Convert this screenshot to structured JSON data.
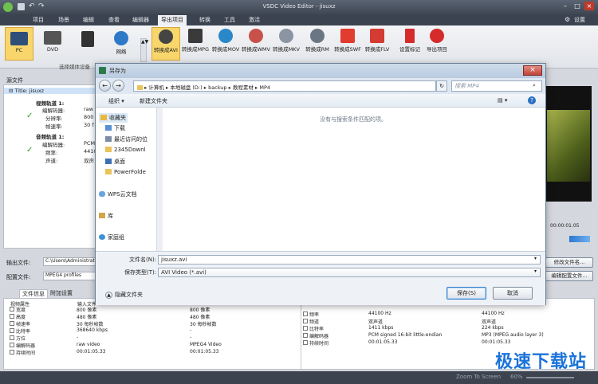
{
  "app": {
    "title": "VSDC Video Editor - jisuxz",
    "settings": "设置"
  },
  "menu": [
    "项目",
    "场景",
    "编辑",
    "查看",
    "编辑器",
    "导出项目",
    "转换",
    "工具",
    "激活"
  ],
  "ribbon": {
    "devices": [
      "PC",
      "DVD",
      "",
      "网络"
    ],
    "formats": [
      "转换成AVI",
      "转换成MPG",
      "转换成MOV",
      "转换成WMV",
      "转换成MKV",
      "转换成RM",
      "转换成SWF",
      "转换成FLV"
    ],
    "markers": [
      "设置标记",
      "导出项目"
    ],
    "group_label": "选择媒体设备"
  },
  "left_panel": {
    "source": "源文件",
    "title": "Title: jisuxz",
    "video_track": "视频轨道 1:",
    "video_props": [
      {
        "k": "编解码器:",
        "v": "raw"
      },
      {
        "k": "分辨率:",
        "v": "800"
      },
      {
        "k": "帧速率:",
        "v": "30 f"
      }
    ],
    "audio_track": "音频轨道 1:",
    "audio_props": [
      {
        "k": "编解码器:",
        "v": "PCM"
      },
      {
        "k": "频率:",
        "v": "4410"
      },
      {
        "k": "声道:",
        "v": "双声"
      }
    ],
    "output_label": "输出文件:",
    "output_value": "C:\\Users\\Administrator",
    "profile_label": "配置文件:",
    "profile_value": "MPEG4 profiles",
    "rename_btn": "修改文件名...",
    "edit_profile_btn": "编辑配置文件..."
  },
  "tabs": [
    "文件信息",
    "附加设置"
  ],
  "file_info": {
    "headers": [
      "视频属性",
      "输入文件"
    ],
    "video_rows": [
      {
        "k": "宽度",
        "in": "800 像素",
        "out": "800 像素"
      },
      {
        "k": "高度",
        "in": "480 像素",
        "out": "480 像素"
      },
      {
        "k": "帧速率",
        "in": "30 每秒帧数",
        "out": "30 每秒帧数"
      },
      {
        "k": "比特率",
        "in": "368640 kbps",
        "out": "-"
      },
      {
        "k": "方位",
        "in": "-",
        "out": "-"
      },
      {
        "k": "编解码器",
        "in": "raw video",
        "out": "MPEG4 Video"
      },
      {
        "k": "持续时间",
        "in": "00:01:05.33",
        "out": "00:01:05.33"
      }
    ],
    "audio_rows": [
      {
        "k": "频率",
        "in": "44100 Hz",
        "out": "44100 Hz"
      },
      {
        "k": "频道",
        "in": "双声道",
        "out": "双声道"
      },
      {
        "k": "比特率",
        "in": "1411 kbps",
        "out": "224 kbps"
      },
      {
        "k": "编解码器",
        "in": "PCM signed 16-bit little-endian",
        "out": "MP3 (MPEG audio layer 3)"
      },
      {
        "k": "持续时间",
        "in": "00:01:05.33",
        "out": "00:01:05.33"
      }
    ]
  },
  "preview": {
    "time": "00:00:01.05"
  },
  "dialog": {
    "title": "另存为",
    "breadcrumb": [
      "计算机",
      "本地磁盘 (D:)",
      "backup",
      "教程素材",
      "MP4"
    ],
    "search_placeholder": "搜索 MP4",
    "organize": "组织",
    "new_folder": "新建文件夹",
    "empty_text": "没有与搜索条件匹配的项。",
    "nav": [
      "收藏夹",
      "下载",
      "最近访问的位",
      "2345Downl",
      "桌面",
      "PowerFolde",
      "WPS云文档",
      "库",
      "家庭组"
    ],
    "filename_label": "文件名(N):",
    "filename_value": "jisuxz.avi",
    "type_label": "保存类型(T):",
    "type_value": "AVI Video (*.avi)",
    "hide_folders": "隐藏文件夹",
    "save": "保存(S)",
    "cancel": "取消"
  },
  "status": {
    "zoom": "Zoom To Screen",
    "zoom_pct": "60%"
  },
  "watermark": "极速下载站"
}
